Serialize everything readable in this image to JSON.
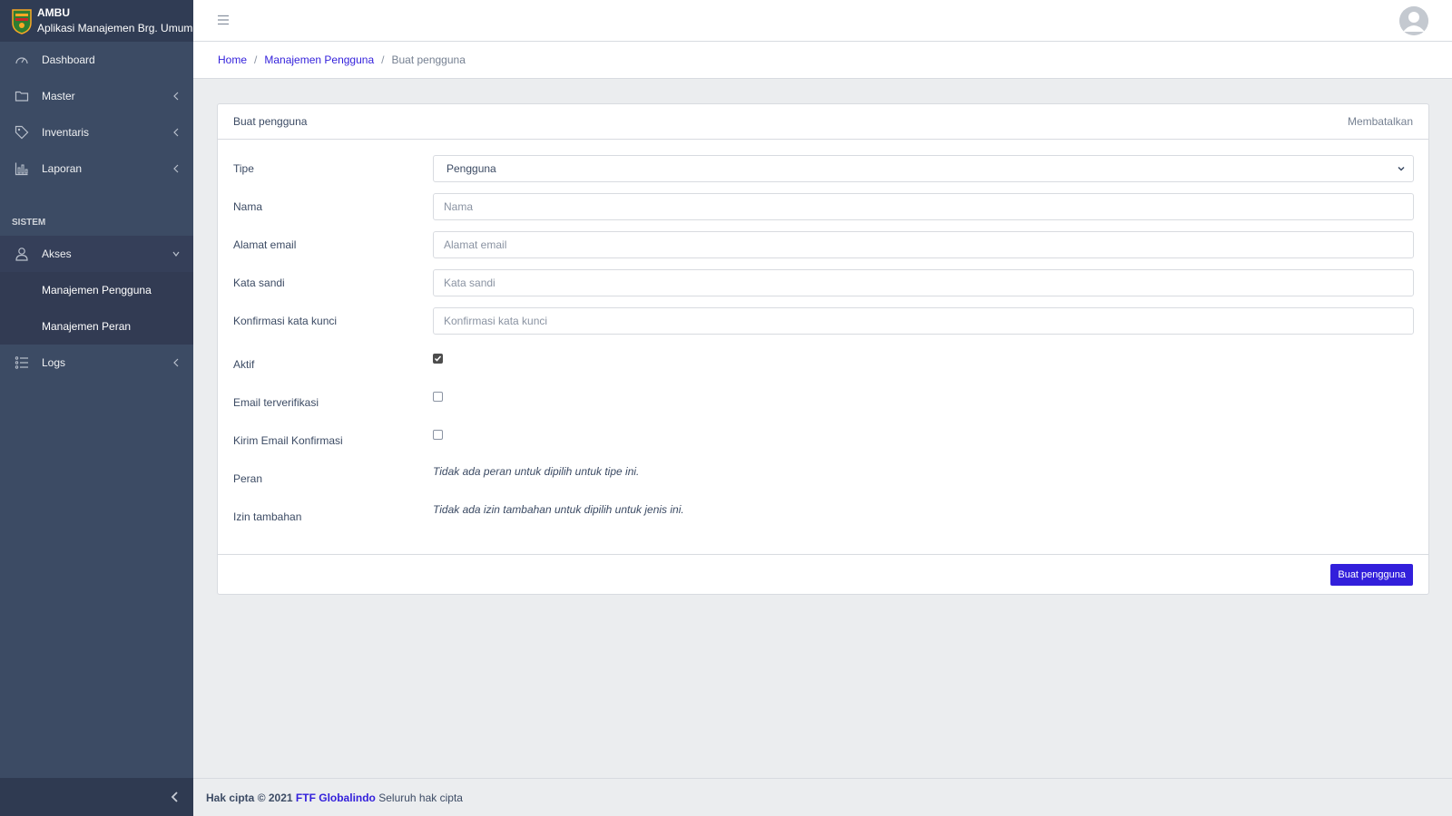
{
  "brand": {
    "name": "AMBU",
    "subtitle": "Aplikasi Manajemen Brg. Umum"
  },
  "sidebar": {
    "items": [
      {
        "label": "Dashboard",
        "icon": "speedometer-icon"
      },
      {
        "label": "Master",
        "icon": "folder-icon"
      },
      {
        "label": "Inventaris",
        "icon": "tag-icon"
      },
      {
        "label": "Laporan",
        "icon": "bar-chart-icon"
      }
    ],
    "section_title": "SISTEM",
    "akses": {
      "label": "Akses",
      "icon": "user-icon"
    },
    "sub_items": [
      {
        "label": "Manajemen Pengguna"
      },
      {
        "label": "Manajemen Peran"
      }
    ],
    "logs": {
      "label": "Logs",
      "icon": "list-icon"
    }
  },
  "breadcrumb": {
    "home": "Home",
    "parent": "Manajemen Pengguna",
    "current": "Buat pengguna"
  },
  "card": {
    "title": "Buat pengguna",
    "cancel": "Membatalkan",
    "submit": "Buat pengguna"
  },
  "form": {
    "tipe": {
      "label": "Tipe",
      "value": "Pengguna"
    },
    "nama": {
      "label": "Nama",
      "placeholder": "Nama"
    },
    "email": {
      "label": "Alamat email",
      "placeholder": "Alamat email"
    },
    "password": {
      "label": "Kata sandi",
      "placeholder": "Kata sandi"
    },
    "confirm": {
      "label": "Konfirmasi kata kunci",
      "placeholder": "Konfirmasi kata kunci"
    },
    "aktif": {
      "label": "Aktif",
      "checked": true
    },
    "verified": {
      "label": "Email terverifikasi",
      "checked": false
    },
    "send_email": {
      "label": "Kirim Email Konfirmasi",
      "checked": false
    },
    "peran": {
      "label": "Peran",
      "note": "Tidak ada peran untuk dipilih untuk tipe ini."
    },
    "izin": {
      "label": "Izin tambahan",
      "note": "Tidak ada izin tambahan untuk dipilih untuk jenis ini."
    }
  },
  "footer": {
    "copyright": "Hak cipta © 2021",
    "company": "FTF Globalindo",
    "rights": "Seluruh hak cipta"
  },
  "colors": {
    "sidebar": "#3c4b64",
    "primary": "#321fdb",
    "background": "#ebedef"
  }
}
